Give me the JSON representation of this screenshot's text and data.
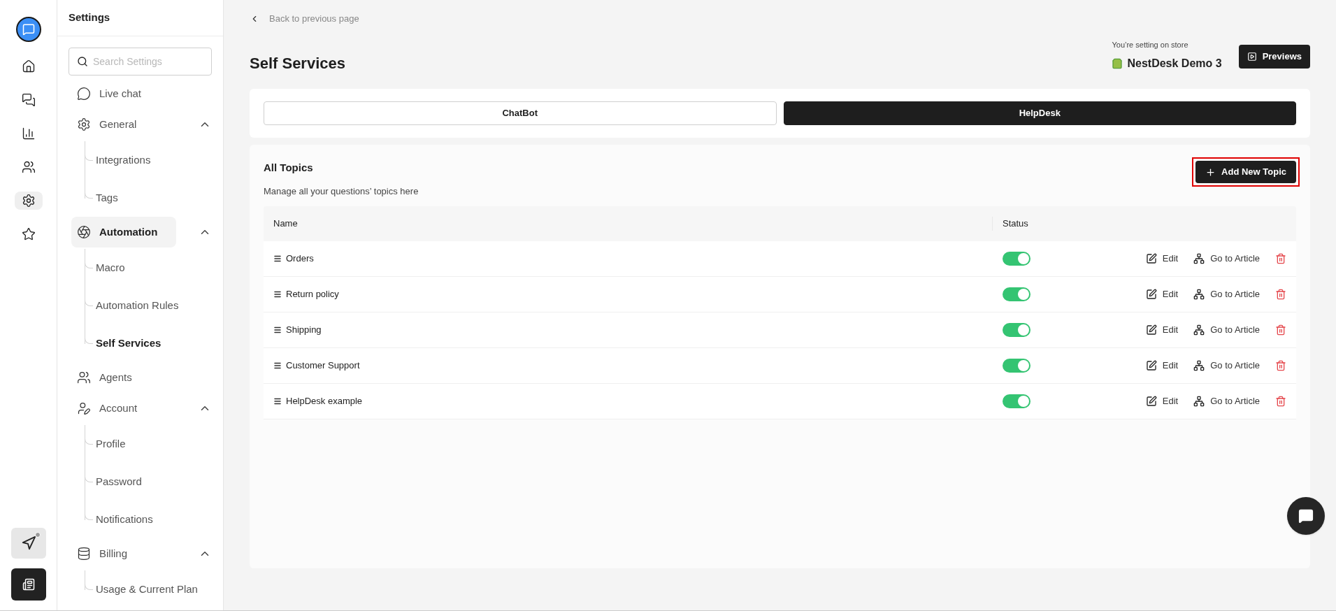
{
  "rail": {
    "items": [
      {
        "kind": "logo",
        "selected": false
      },
      {
        "kind": "home",
        "selected": false
      },
      {
        "kind": "chats",
        "selected": false
      },
      {
        "kind": "reports",
        "selected": false
      },
      {
        "kind": "users",
        "selected": false
      },
      {
        "kind": "settings",
        "selected": true
      },
      {
        "kind": "star",
        "selected": false
      }
    ],
    "bottom": [
      {
        "kind": "launcher",
        "badge": true
      },
      {
        "kind": "notes",
        "badge": false
      }
    ]
  },
  "sidebar": {
    "title": "Settings",
    "search": {
      "placeholder": "Search Settings"
    },
    "items": [
      {
        "label": "Live chat",
        "kind": "chat",
        "selected": false
      },
      {
        "label": "General",
        "kind": "gear",
        "selected": false,
        "expanded": true,
        "children": [
          {
            "label": "Integrations",
            "selected": false
          },
          {
            "label": "Tags",
            "selected": false
          }
        ]
      },
      {
        "label": "Automation",
        "kind": "automation",
        "selected": true,
        "expanded": true,
        "children": [
          {
            "label": "Macro",
            "selected": false
          },
          {
            "label": "Automation Rules",
            "selected": false
          },
          {
            "label": "Self Services",
            "selected": true
          }
        ]
      },
      {
        "label": "Agents",
        "kind": "agents",
        "selected": false
      },
      {
        "label": "Account",
        "kind": "account",
        "selected": false,
        "expanded": true,
        "children": [
          {
            "label": "Profile",
            "selected": false
          },
          {
            "label": "Password",
            "selected": false
          },
          {
            "label": "Notifications",
            "selected": false
          }
        ]
      },
      {
        "label": "Billing",
        "kind": "billing",
        "selected": false,
        "expanded": true,
        "children": [
          {
            "label": "Usage & Current Plan",
            "selected": false
          }
        ]
      }
    ]
  },
  "header": {
    "back": "Back to previous page",
    "title": "Self Services",
    "store_caption": "You’re setting on store",
    "store_name": "NestDesk Demo 3",
    "preview_button": "Previews"
  },
  "tabs": [
    {
      "label": "ChatBot",
      "selected": false
    },
    {
      "label": "HelpDesk",
      "selected": true
    }
  ],
  "topics": {
    "title": "All Topics",
    "subtitle": "Manage all your questions’ topics here",
    "add_button": {
      "label": "Add New Topic",
      "highlighted": true
    },
    "columns": [
      "Name",
      "Status"
    ],
    "rows": [
      {
        "name": "Orders",
        "on": true,
        "edit": "Edit",
        "go": "Go to Article"
      },
      {
        "name": "Return policy",
        "on": true,
        "edit": "Edit",
        "go": "Go to Article"
      },
      {
        "name": "Shipping",
        "on": true,
        "edit": "Edit",
        "go": "Go to Article"
      },
      {
        "name": "Customer Support",
        "on": true,
        "edit": "Edit",
        "go": "Go to Article"
      },
      {
        "name": "HelpDesk example",
        "on": true,
        "edit": "Edit",
        "go": "Go to Article"
      }
    ]
  }
}
